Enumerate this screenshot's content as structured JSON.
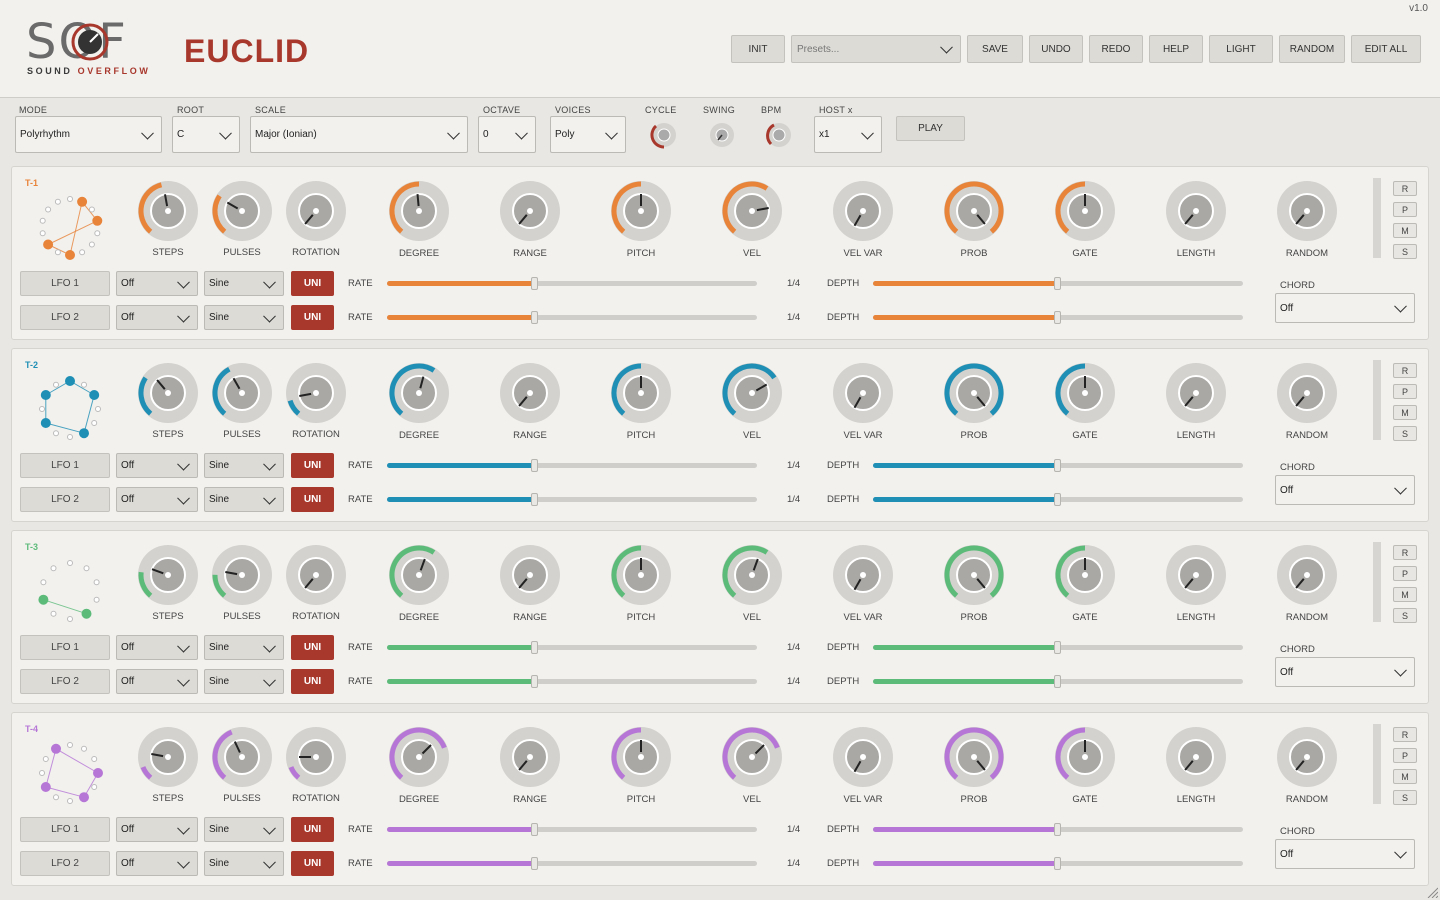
{
  "app": {
    "logo_letters": "SOF",
    "logo_sub_1": "SOUND",
    "logo_sub_2": "OVERFLOW",
    "title": "EUCLID",
    "version": "v1.0"
  },
  "toolbar": {
    "init": "INIT",
    "presets_placeholder": "Presets...",
    "save": "SAVE",
    "undo": "UNDO",
    "redo": "REDO",
    "help": "HELP",
    "light": "LIGHT",
    "random": "RANDOM",
    "edit_all": "EDIT ALL"
  },
  "global": {
    "mode_label": "MODE",
    "mode_value": "Polyrhythm",
    "root_label": "ROOT",
    "root_value": "C",
    "scale_label": "SCALE",
    "scale_value": "Major (Ionian)",
    "octave_label": "OCTAVE",
    "octave_value": "0",
    "voices_label": "VOICES",
    "voices_value": "Poly",
    "cycle_label": "CYCLE",
    "swing_label": "SWING",
    "bpm_label": "BPM",
    "host_label": "HOST x",
    "host_value": "x1",
    "play": "PLAY"
  },
  "knob_labels": [
    "STEPS",
    "PULSES",
    "ROTATION",
    "DEGREE",
    "RANGE",
    "PITCH",
    "VEL",
    "VEL VAR",
    "PROB",
    "GATE",
    "LENGTH",
    "RANDOM"
  ],
  "row_labels": {
    "lfo1": "LFO 1",
    "lfo2": "LFO 2",
    "target": "Off",
    "shape": "Sine",
    "uni": "UNI",
    "rate": "RATE",
    "rate_value": "1/4",
    "depth": "DEPTH",
    "chord": "CHORD",
    "chord_value": "Off",
    "r": "R",
    "p": "P",
    "m": "M",
    "s": "S"
  },
  "tracks": [
    {
      "name": "T-1",
      "color": "#e8843a"
    },
    {
      "name": "T-2",
      "color": "#1f8fb5"
    },
    {
      "name": "T-3",
      "color": "#5dbb7a"
    },
    {
      "name": "T-4",
      "color": "#b676d6"
    }
  ]
}
